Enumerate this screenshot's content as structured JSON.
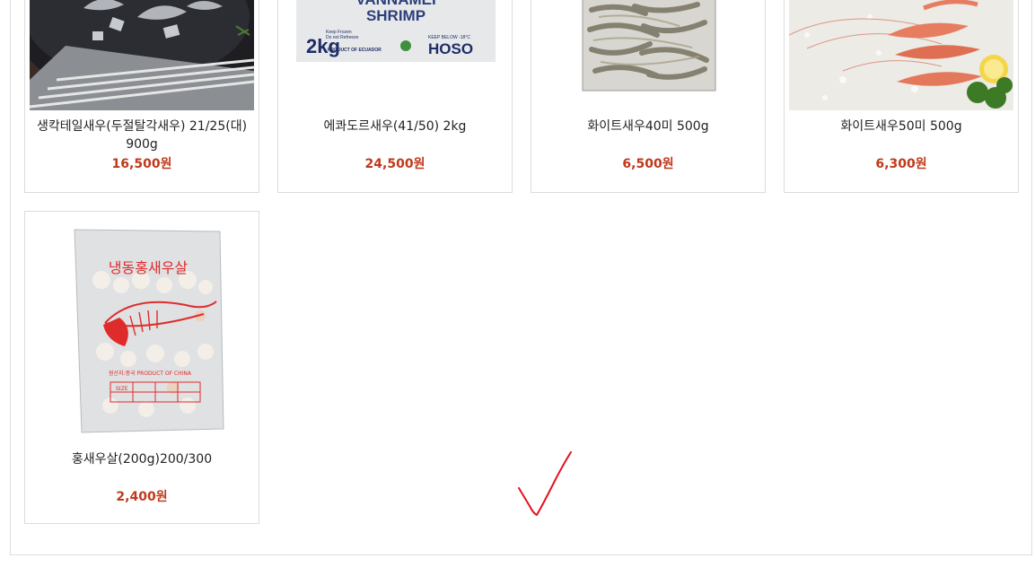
{
  "products": [
    {
      "name": "생칵테일새우(두절탈각새우) 21/25(대) 900g",
      "price": "16,500원"
    },
    {
      "name": "에콰도르새우(41/50) 2kg",
      "price": "24,500원",
      "box": {
        "line1": "VANNAMEI",
        "line2": "SHRIMP",
        "weight": "2kg",
        "note1": "Keep Frozen",
        "note2": "Do not Refreeze",
        "origin": "PRODUCT OF ECUADOR",
        "temp": "KEEP BELOW -18°C",
        "brand": "HOSO"
      }
    },
    {
      "name": "화이트새우40미 500g",
      "price": "6,500원"
    },
    {
      "name": "화이트새우50미 500g",
      "price": "6,300원"
    },
    {
      "name": "홍새우살(200g)200/300",
      "price": "2,400원",
      "bag": {
        "title": "냉동홍새우살",
        "origin": "원산지:중국 PRODUCT OF CHINA",
        "size": "SIZE"
      }
    }
  ],
  "colors": {
    "price": "#c0391b",
    "border": "#dcdcdc",
    "annotation": "#e0141e"
  }
}
